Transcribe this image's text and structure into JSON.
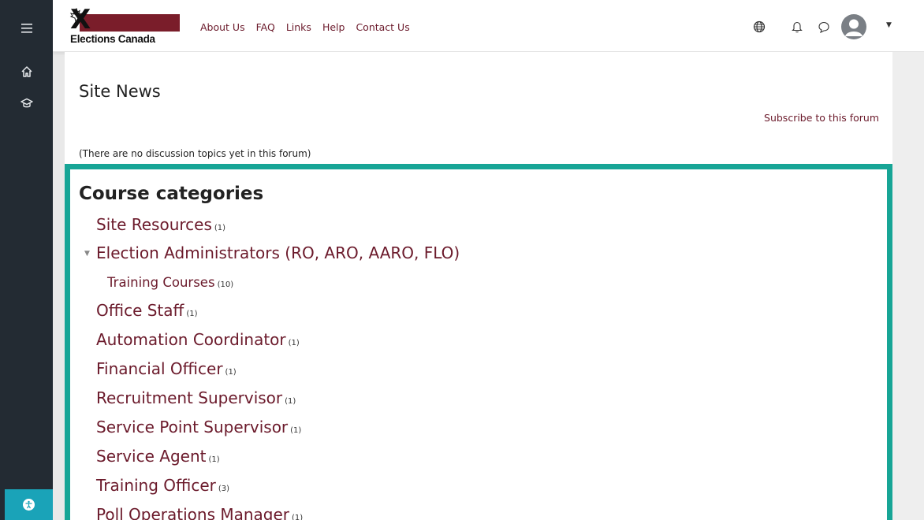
{
  "rail": {
    "menu_icon": "hamburger-icon",
    "home_icon": "home-icon",
    "courses_icon": "graduation-cap-icon",
    "accessibility_icon": "accessibility-icon"
  },
  "navbar": {
    "logo_text": "Elections Canada",
    "links": [
      "About Us",
      "FAQ",
      "Links",
      "Help",
      "Contact Us"
    ],
    "icons": [
      "globe-icon",
      "bell-icon",
      "chat-icon",
      "user-avatar-icon"
    ]
  },
  "site_news": {
    "title": "Site News",
    "subscribe": "Subscribe to this forum",
    "empty_message": "(There are no discussion topics yet in this forum)"
  },
  "categories": {
    "title": "Course categories",
    "items": [
      {
        "label": "Site Resources",
        "count": "(1)"
      },
      {
        "label": "Election Administrators (RO, ARO, AARO, FLO)",
        "count": ""
      },
      {
        "label": "Training Courses",
        "count": "(10)"
      },
      {
        "label": "Office Staff",
        "count": "(1)"
      },
      {
        "label": "Automation Coordinator",
        "count": "(1)"
      },
      {
        "label": "Financial Officer",
        "count": "(1)"
      },
      {
        "label": "Recruitment Supervisor",
        "count": "(1)"
      },
      {
        "label": "Service Point Supervisor",
        "count": "(1)"
      },
      {
        "label": "Service Agent",
        "count": "(1)"
      },
      {
        "label": "Training Officer",
        "count": "(3)"
      },
      {
        "label": "Poll Operations Manager",
        "count": "(1)"
      }
    ]
  },
  "colors": {
    "brand": "#6b1a2b",
    "highlight": "#17a596",
    "rail": "#232b33",
    "accessibility": "#1aa3b8"
  }
}
